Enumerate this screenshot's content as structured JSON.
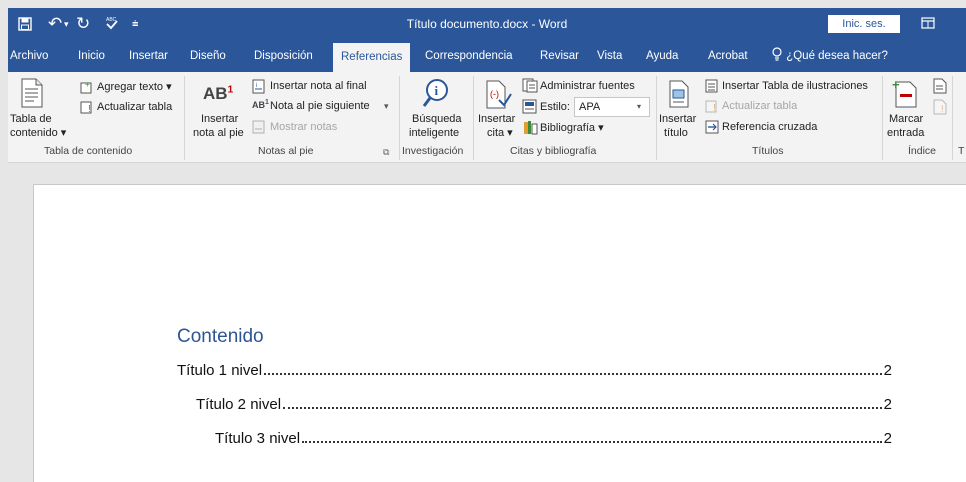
{
  "titlebar": {
    "title": "Título documento.docx  -  Word",
    "signin": "Inic. ses.",
    "qa_icons": [
      "save-icon",
      "undo-icon",
      "redo-icon",
      "spelling-icon",
      "customize-icon"
    ]
  },
  "tabs": {
    "items": [
      "Archivo",
      "Inicio",
      "Insertar",
      "Diseño",
      "Disposición",
      "Referencias",
      "Correspondencia",
      "Revisar",
      "Vista",
      "Ayuda",
      "Acrobat"
    ],
    "active": "Referencias",
    "tell_me": "¿Qué desea hacer?"
  },
  "ribbon": {
    "toc": {
      "big_label_1": "Tabla de",
      "big_label_2": "contenido ▾",
      "add_text": "Agregar texto ▾",
      "update_table": "Actualizar tabla",
      "group": "Tabla de contenido"
    },
    "footnotes": {
      "big_label_1": "Insertar",
      "big_label_2": "nota al pie",
      "insert_endnote": "Insertar nota al final",
      "next_footnote": "Nota al pie siguiente",
      "show_notes": "Mostrar notas",
      "group": "Notas al pie"
    },
    "research": {
      "big_label_1": "Búsqueda",
      "big_label_2": "inteligente",
      "group": "Investigación"
    },
    "citations": {
      "big_label_1": "Insertar",
      "big_label_2": "cita ▾",
      "manage_sources": "Administrar fuentes",
      "style_label": "Estilo:",
      "style_value": "APA",
      "bibliography": "Bibliografía ▾",
      "group": "Citas y bibliografía"
    },
    "captions": {
      "big_label_1": "Insertar",
      "big_label_2": "título",
      "insert_table_figures": "Insertar Tabla de ilustraciones",
      "update_table": "Actualizar tabla",
      "cross_reference": "Referencia cruzada",
      "group": "Títulos"
    },
    "index": {
      "big_label_1": "Marcar",
      "big_label_2": "entrada",
      "group": "Índice",
      "next_group_initial": "T"
    }
  },
  "document": {
    "toc_heading": "Contenido",
    "entries": [
      {
        "label": "Título 1 nivel",
        "page": "2"
      },
      {
        "label": "Título 2 nivel",
        "page": "2"
      },
      {
        "label": "Título 3 nivel",
        "page": "2"
      }
    ]
  }
}
